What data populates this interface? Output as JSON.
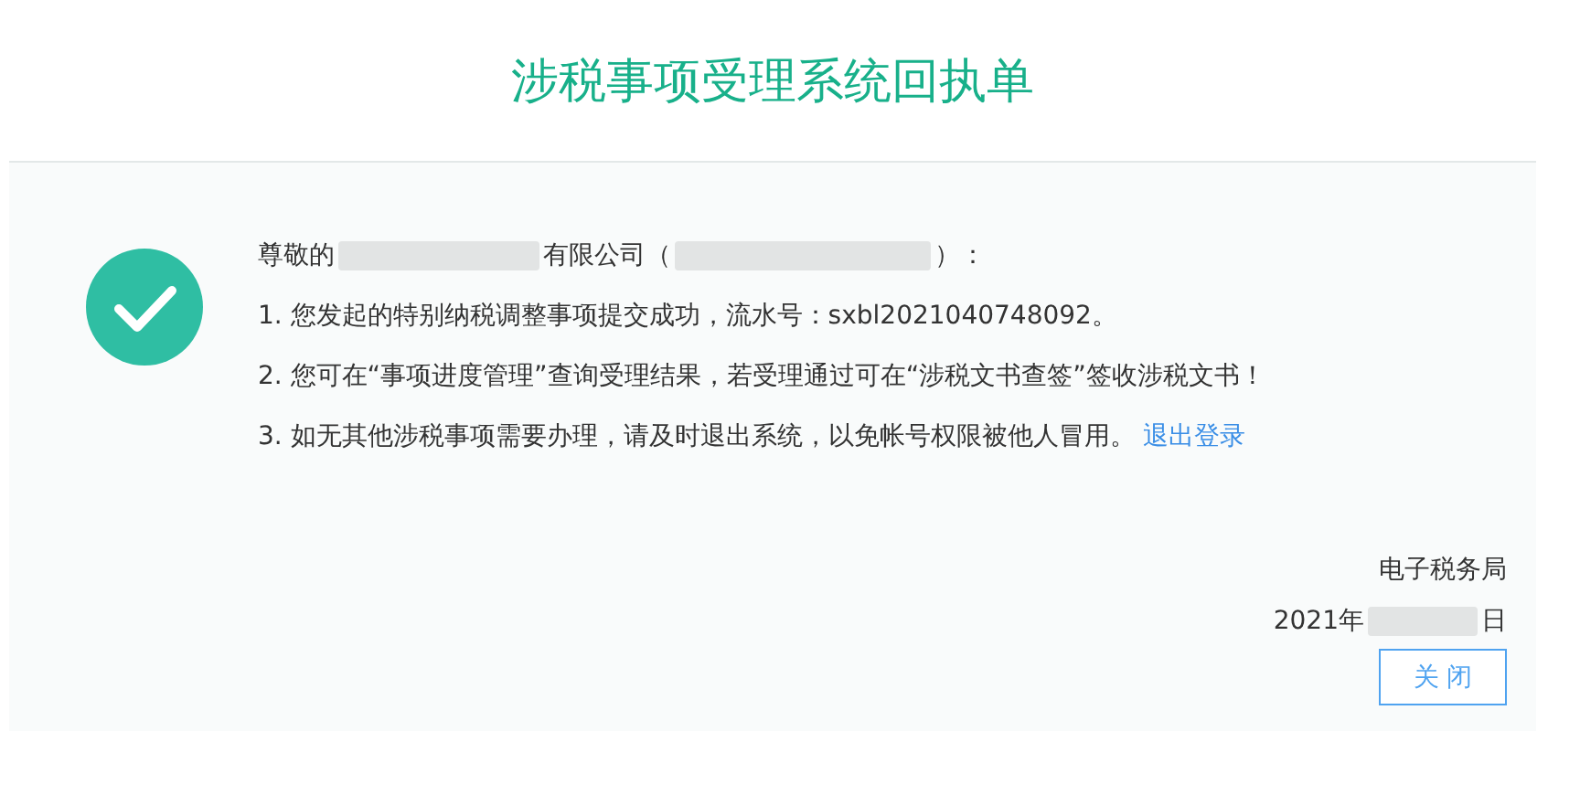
{
  "title": "涉税事项受理系统回执单",
  "greeting": {
    "prefix": "尊敬的",
    "middle": "有限公司（",
    "suffix": "）："
  },
  "items": [
    {
      "text": "1. 您发起的特别纳税调整事项提交成功，流水号：sxbl2021040748092。"
    },
    {
      "text": "2. 您可在“事项进度管理”查询受理结果，若受理通过可在“涉税文书查签”签收涉税文书！"
    },
    {
      "text": "3. 如无其他涉税事项需要办理，请及时退出系统，以免帐号权限被他人冒用。",
      "link": "退出登录"
    }
  ],
  "signature": "电子税务局",
  "date": {
    "prefix": "2021年",
    "suffix": "日"
  },
  "close_button": "关 闭"
}
